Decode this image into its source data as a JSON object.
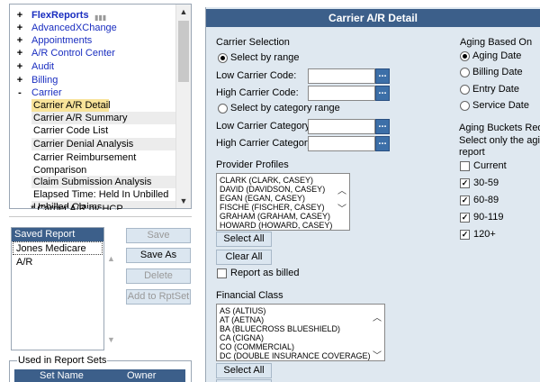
{
  "tree": {
    "nodes": [
      {
        "pm": "+",
        "label": "FlexReports"
      },
      {
        "pm": "+",
        "label": "AdvancedXChange"
      },
      {
        "pm": "+",
        "label": "Appointments"
      },
      {
        "pm": "+",
        "label": "A/R Control Center"
      },
      {
        "pm": "+",
        "label": "Audit"
      },
      {
        "pm": "+",
        "label": "Billing"
      },
      {
        "pm": "-",
        "label": "Carrier"
      }
    ],
    "leaves": [
      "Carrier A/R Detail",
      "Carrier A/R Summary",
      "Carrier Code List",
      "Carrier Denial Analysis",
      "Carrier Reimbursement Comparison",
      "Claim Submission Analysis",
      "Elapsed Time: Held In Unbilled",
      "Unbilled Claims"
    ],
    "cut_off_item": "* Carrier A/R by HCP"
  },
  "saved_settings": {
    "header": "Saved Report Settings",
    "rows": [
      "Jones Medicare A/R"
    ]
  },
  "buttons": {
    "save": "Save",
    "save_as": "Save As",
    "delete": "Delete",
    "add_to_rptset": "Add to RptSet"
  },
  "used_in_sets": {
    "legend": "Used in Report Sets",
    "col_set_name": "Set Name",
    "col_owner": "Owner"
  },
  "panel": {
    "title": "Carrier A/R Detail",
    "carrier_selection": {
      "label": "Carrier Selection",
      "by_range": "Select by range",
      "low_code": "Low Carrier Code:",
      "high_code": "High Carrier Code:",
      "by_category": "Select by category range",
      "low_cat": "Low Carrier Category:",
      "high_cat": "High Carrier Category:",
      "ellipsis": "..."
    },
    "provider_profiles": {
      "label": "Provider Profiles",
      "items": [
        "CLARK (CLARK, CASEY)",
        "DAVID (DAVIDSON, CASEY)",
        "EGAN (EGAN, CASEY)",
        "FISCHE (FISCHER, CASEY)",
        "GRAHAM (GRAHAM, CASEY)",
        "HOWARD (HOWARD, CASEY)"
      ],
      "select_all": "Select All",
      "clear_all": "Clear All",
      "report_as_billed": "Report as billed"
    },
    "financial_class": {
      "label": "Financial Class",
      "items": [
        "AS (ALTIUS)",
        "AT (AETNA)",
        "BA (BLUECROSS BLUESHIELD)",
        "CA (CIGNA)",
        "CO (COMMERCIAL)",
        "DC (DOUBLE INSURANCE COVERAGE)"
      ],
      "select_all": "Select All"
    },
    "aging_based_on": {
      "label": "Aging Based On",
      "options": [
        "Aging Date",
        "Billing Date",
        "Entry Date",
        "Service Date"
      ]
    },
    "aging_buckets": {
      "label": "Aging Buckets Requ",
      "hint1": "Select only the aging",
      "hint2": "report",
      "options": [
        {
          "label": "Current",
          "checked": false
        },
        {
          "label": "30-59",
          "checked": true
        },
        {
          "label": "60-89",
          "checked": true
        },
        {
          "label": "90-119",
          "checked": true
        },
        {
          "label": "120+",
          "checked": true
        }
      ]
    }
  },
  "colors": {
    "header_blue": "#3c5f8a",
    "link_blue": "#1a2ec0",
    "selected": "#f8e39a",
    "panel_bg": "#dfe8f0"
  }
}
